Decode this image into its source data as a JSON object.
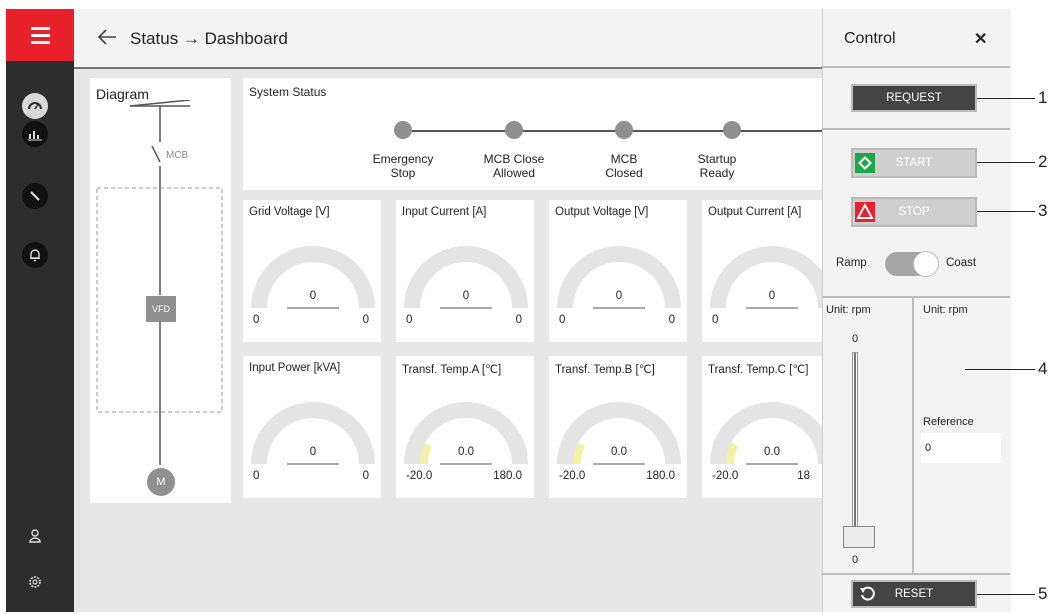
{
  "header": {
    "title": "Status → Dashboard"
  },
  "sidebar": {
    "icons": [
      "menu-icon",
      "gauge-icon",
      "chart-icon",
      "wrench-icon",
      "bell-icon",
      "user-icon",
      "gear-icon"
    ]
  },
  "diagram": {
    "title": "Diagram",
    "mcb_label": "MCB",
    "vfd_label": "VFD",
    "motor_label": "M"
  },
  "system_status": {
    "title": "System Status",
    "steps": [
      {
        "label_line1": "Emergency",
        "label_line2": "Stop"
      },
      {
        "label_line1": "MCB Close",
        "label_line2": "Allowed"
      },
      {
        "label_line1": "MCB",
        "label_line2": "Closed"
      },
      {
        "label_line1": "Startup",
        "label_line2": "Ready"
      }
    ]
  },
  "gauges": [
    {
      "title": "Grid Voltage [V]",
      "value": "0",
      "min": "0",
      "max": "0"
    },
    {
      "title": "Input Current [A]",
      "value": "0",
      "min": "0",
      "max": "0"
    },
    {
      "title": "Output Voltage [V]",
      "value": "0",
      "min": "0",
      "max": "0"
    },
    {
      "title": "Output Current [A]",
      "value": "0",
      "min": "0",
      "max": ""
    },
    {
      "title": "Input Power [kVA]",
      "value": "0",
      "min": "0",
      "max": "0"
    },
    {
      "title": "Transf. Temp.A [℃]",
      "value": "0.0",
      "min": "-20.0",
      "max": "180.0"
    },
    {
      "title": "Transf. Temp.B [℃]",
      "value": "0.0",
      "min": "-20.0",
      "max": "180.0"
    },
    {
      "title": "Transf. Temp.C [℃]",
      "value": "0.0",
      "min": "-20.0",
      "max": "18"
    }
  ],
  "control": {
    "title": "Control",
    "close": "✕",
    "request_label": "REQUEST",
    "start_label": "START",
    "stop_label": "STOP",
    "ramp_label": "Ramp",
    "coast_label": "Coast",
    "unit_left": "Unit: rpm",
    "unit_right": "Unit: rpm",
    "slider_max": "0",
    "slider_min": "0",
    "reference_label": "Reference",
    "reference_value": "0",
    "reset_label": "RESET"
  },
  "callouts": [
    "1",
    "2",
    "3",
    "4",
    "5"
  ],
  "colors": {
    "brand_red": "#e8202a",
    "start_green": "#1aa84a",
    "stop_red": "#e8202a",
    "gauge_warn": "#f5f0a8"
  }
}
